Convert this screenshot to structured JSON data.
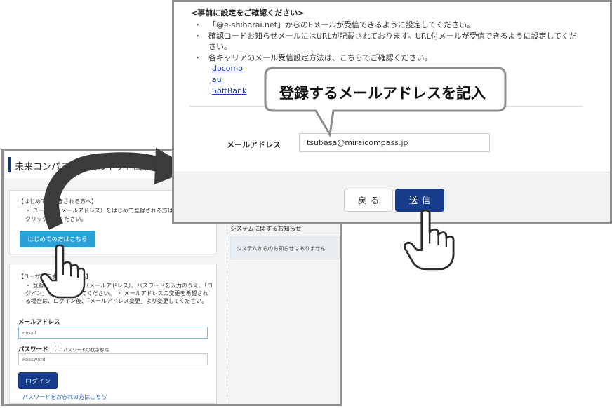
{
  "back_screen": {
    "title": "未来コンパス中学校のネット出願へようこそ",
    "first_box": {
      "heading": "【はじめて手続きされる方へ】",
      "body": "・ ユーザID（メールアドレス）をはじめて登録される方は、下のボタンをクリックしてください。",
      "button": "はじめての方はこちら"
    },
    "login_box": {
      "heading": "【ユーザIDをお持ちの方へ】",
      "body": "・ 登録済みのユーザID（メールアドレス）、パスワードを入力のうえ、「ログイン」をクリックしてください。 ・ メールアドレスの変更を希望される場合は、ログイン後、「メールアドレス変更」より変更してください。",
      "email_label": "メールアドレス",
      "email_placeholder": "email",
      "password_label": "パスワード",
      "show_password_label": "パスワードの伏字解除",
      "password_placeholder": "Password",
      "login_button": "ログイン",
      "forgot_link": "パスワードをお忘れの方はこちら"
    },
    "side": {
      "heading": "システムに関するお知らせ",
      "notice": "システムからのお知らせはありません"
    }
  },
  "front_screen": {
    "heading": "<事前に設定をご確認ください>",
    "bullets": [
      "「@e-shiharai.net」からのEメールが受信できるように設定してください。",
      "確認コードお知らせメールにはURLが記載されております。URL付メールが受信できるように設定してください。",
      "各キャリアのメール受信設定方法は、こちらでご確認ください。"
    ],
    "bullet_mark": "・",
    "links": [
      "docomo",
      "au",
      "SoftBank"
    ],
    "email_label": "メールアドレス",
    "email_value": "tsubasa@miraicompass.jp",
    "back_button": "戻る",
    "send_button": "送信"
  },
  "callout": {
    "text": "登録するメールアドレスを記入"
  },
  "colors": {
    "primary_button": "#163b8a",
    "first_button": "#2aa0d6",
    "link": "#1a3fa8",
    "arrow": "#3b3b3b"
  },
  "icons": {
    "arrow": "curved-arrow-icon",
    "hand": "pointing-hand-icon"
  }
}
